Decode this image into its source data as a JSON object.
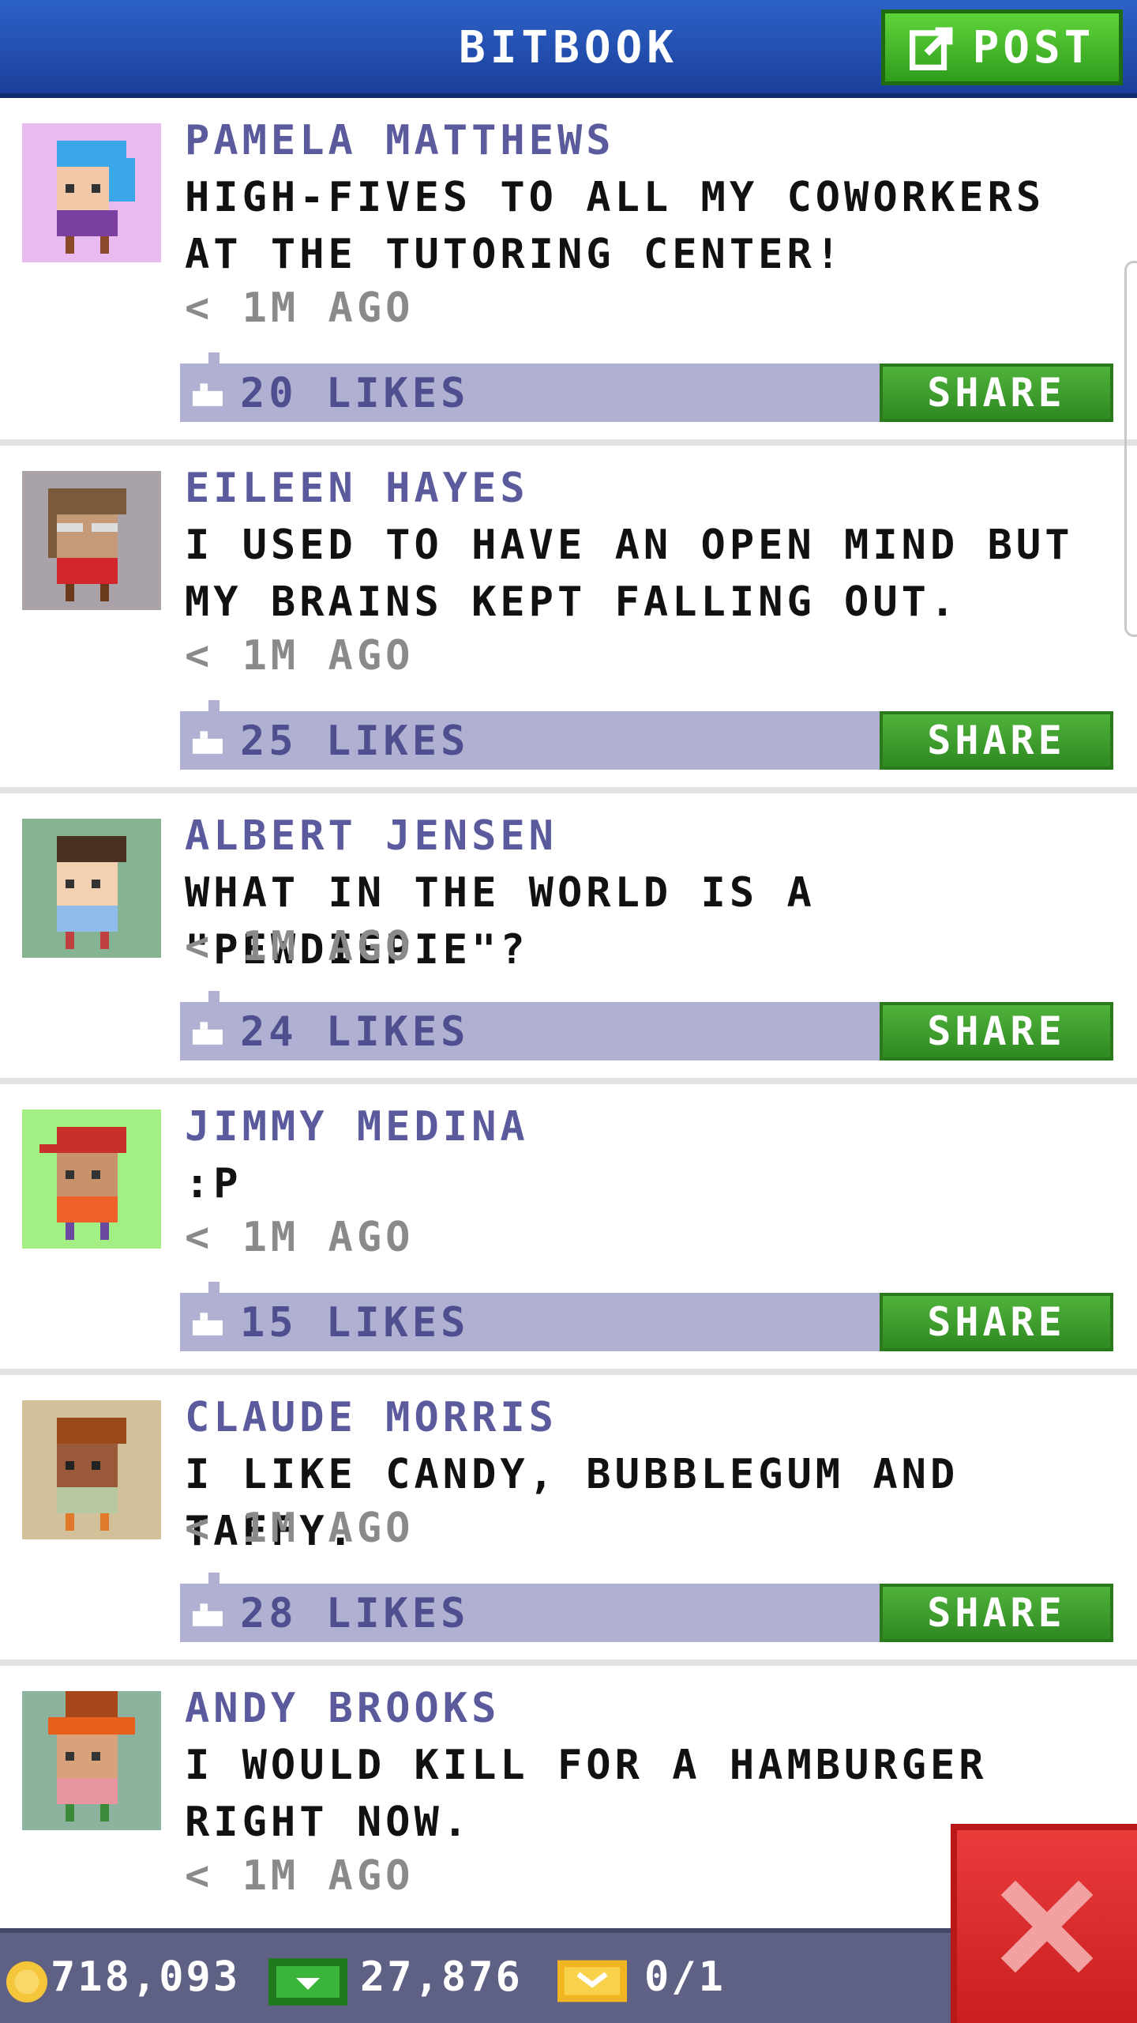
{
  "header": {
    "title": "BITBOOK",
    "post_label": "POST"
  },
  "colors": {
    "header_blue": "#2d62c9",
    "post_green": "#4cc02e",
    "like_bar": "#b0b0d3",
    "share_green": "#3f9f2e",
    "close_red": "#e03030",
    "author_text": "#5a5a9c"
  },
  "feed": {
    "share_label": "SHARE",
    "posts": [
      {
        "author": "PAMELA MATTHEWS",
        "message": "HIGH-FIVES TO ALL MY COWORKERS AT THE TUTORING CENTER!",
        "time": "< 1M AGO",
        "likes": "20 LIKES",
        "avatar_icon": "pink-haired-woman-avatar",
        "avatar_bg": "#e9baf0"
      },
      {
        "author": "EILEEN HAYES",
        "message": "I USED TO HAVE AN OPEN MIND BUT MY BRAINS KEPT FALLING OUT.",
        "time": "< 1M AGO",
        "likes": "25 LIKES",
        "avatar_icon": "glasses-woman-avatar",
        "avatar_bg": "#a9a2a9"
      },
      {
        "author": "ALBERT JENSEN",
        "message": "WHAT IN THE WORLD IS A \"PEWDIEPIE\"?",
        "time": "< 1M AGO",
        "likes": "24 LIKES",
        "avatar_icon": "brown-haired-man-avatar",
        "avatar_bg": "#86b392"
      },
      {
        "author": "JIMMY MEDINA",
        "message": ":P",
        "time": "< 1M AGO",
        "likes": "15 LIKES",
        "avatar_icon": "red-cap-man-avatar",
        "avatar_bg": "#a2ef84"
      },
      {
        "author": "CLAUDE MORRIS",
        "message": "I LIKE CANDY, BUBBLEGUM AND TAFFY.",
        "time": "< 1M AGO",
        "likes": "28 LIKES",
        "avatar_icon": "dark-skinned-man-avatar",
        "avatar_bg": "#d2c09a"
      },
      {
        "author": "ANDY BROOKS",
        "message": "I WOULD KILL FOR A HAMBURGER RIGHT NOW.",
        "time": "< 1M AGO",
        "likes": "",
        "avatar_icon": "orange-hat-man-avatar",
        "avatar_bg": "#8db39e"
      }
    ]
  },
  "status": {
    "coins": "718,093",
    "bux": "27,876",
    "tickets": "0/1"
  }
}
